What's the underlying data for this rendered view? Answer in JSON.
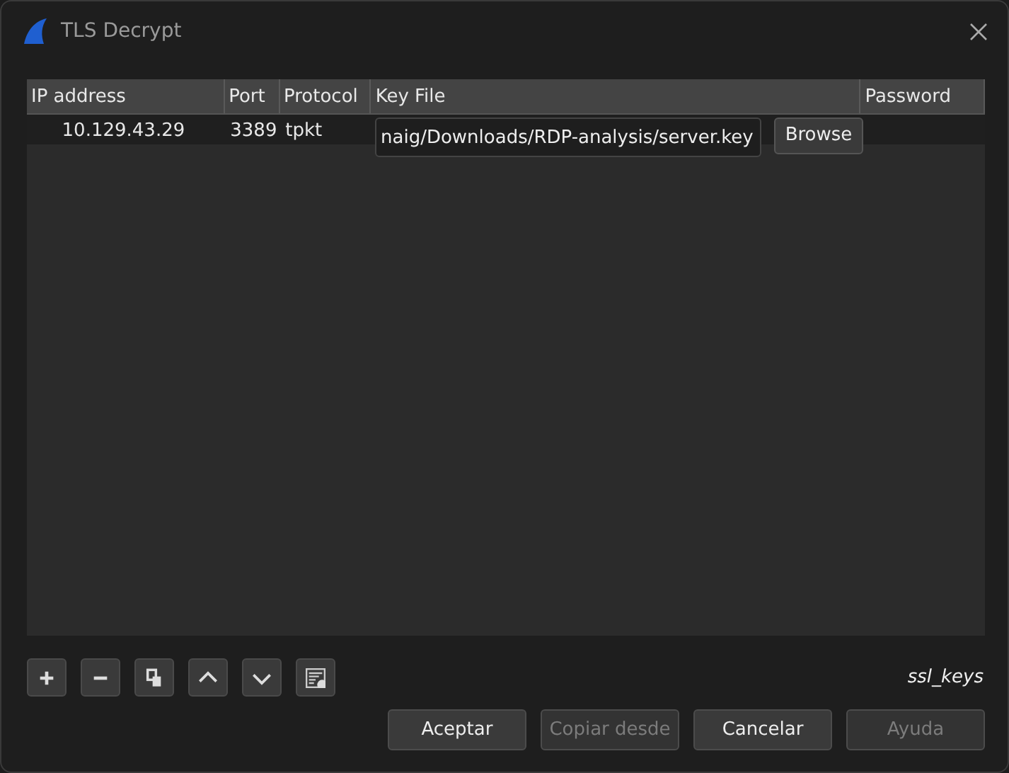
{
  "window": {
    "title": "TLS Decrypt"
  },
  "table": {
    "columns": [
      "IP address",
      "Port",
      "Protocol",
      "Key File",
      "Password"
    ],
    "rows": [
      {
        "cells": [
          "10.129.43.29",
          "3389",
          "tpkt"
        ],
        "editor": {
          "value": "naig/Downloads/RDP-analysis/server.key",
          "button": "Browse"
        }
      }
    ]
  },
  "toolbar": [
    {
      "kind": "add"
    },
    {
      "kind": "remove"
    },
    {
      "kind": "copy"
    },
    {
      "kind": "up"
    },
    {
      "kind": "down"
    },
    {
      "kind": "clear"
    }
  ],
  "file_label": "ssl_keys",
  "buttons": [
    {
      "label": "Aceptar",
      "disabled": false
    },
    {
      "label": "Copiar desde",
      "disabled": true
    },
    {
      "label": "Cancelar",
      "disabled": false
    },
    {
      "label": "Ayuda",
      "disabled": true
    }
  ]
}
